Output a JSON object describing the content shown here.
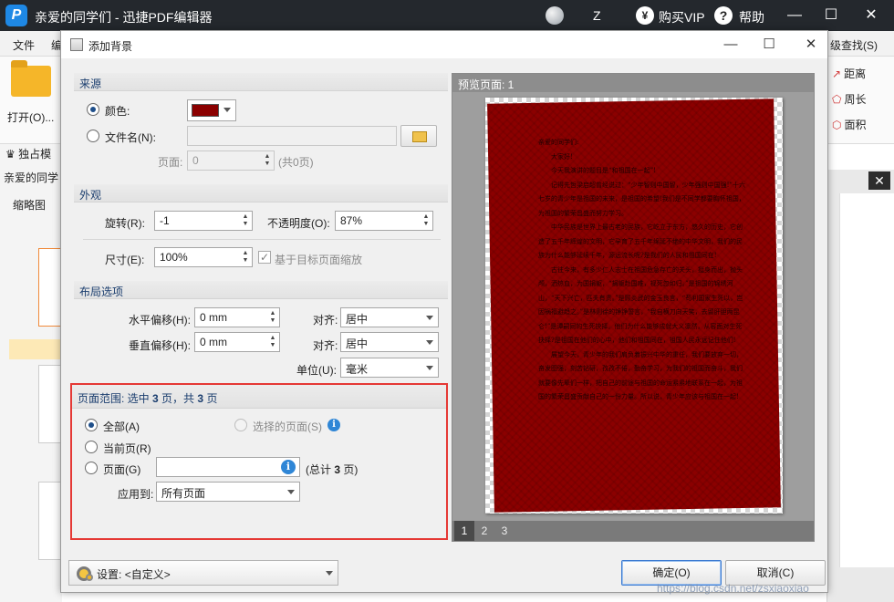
{
  "app": {
    "title": "亲爱的同学们 - 迅捷PDF编辑器",
    "logo": "P",
    "user": "Z",
    "vip_icon": "¥",
    "buy_vip": "购买VIP",
    "help_icon": "?",
    "help": "帮助",
    "minimize": "—",
    "maximize": "☐",
    "close": "✕"
  },
  "backdrop": {
    "menu": [
      "文件",
      "编"
    ],
    "menu_right": "级查找(S)",
    "open_label": "打开(O)...",
    "exclusive": "独占模",
    "doc_tab": "亲爱的同学",
    "thumbs_title": "缩略图",
    "right_tools": [
      "距离",
      "周长",
      "面积"
    ],
    "panel_close": "✕"
  },
  "dialog": {
    "title": "添加背景",
    "minimize": "—",
    "maximize": "☐",
    "close": "✕",
    "source": {
      "header": "来源",
      "color_label": "颜色:",
      "color_value": "#8b0000",
      "file_label": "文件名(N):",
      "file_value": "",
      "page_label": "页面:",
      "page_value": "0",
      "page_total": "(共0页)"
    },
    "appearance": {
      "header": "外观",
      "rotate_label": "旋转(R):",
      "rotate_value": "-1",
      "opacity_label": "不透明度(O):",
      "opacity_value": "87%",
      "size_label": "尺寸(E):",
      "size_value": "100%",
      "scale_label": "基于目标页面缩放",
      "scale_checked": true
    },
    "layout": {
      "header": "布局选项",
      "h_offset_label": "水平偏移(H):",
      "h_offset_value": "0 mm",
      "h_align_label": "对齐:",
      "h_align_value": "居中",
      "v_offset_label": "垂直偏移(H):",
      "v_offset_value": "0 mm",
      "v_align_label": "对齐:",
      "v_align_value": "居中",
      "unit_label": "单位(U):",
      "unit_value": "毫米"
    },
    "range": {
      "header_prefix": "页面范围: 选中",
      "selected": "3",
      "header_mid": "页，共",
      "total": "3",
      "header_suffix": "页",
      "all_label": "全部(A)",
      "selected_pages_label": "选择的页面(S)",
      "current_label": "当前页(R)",
      "pages_label": "页面(G)",
      "pages_value": "",
      "pages_total_prefix": "(总计",
      "pages_total": "3",
      "pages_total_suffix": "页)",
      "apply_label": "应用到:",
      "apply_value": "所有页面"
    },
    "preview": {
      "header": "预览页面: 1",
      "pages": [
        "1",
        "2",
        "3"
      ],
      "text": {
        "greeting": "亲爱的同学们:",
        "hello": "大家好!",
        "p1": "今天我演讲的题目是“和祖国在一起”!",
        "p2": "记得先哲梁启超曾经说过：“少年智则中国智，少年强则中国强!”十六七岁的青少年是祖国的未来，是祖国的希望!我们是不同学都要胸怀祖国，为祖国的繁荣昌盛而努力学习。",
        "p3": "中华民族是世界上最古老的民族，它屹立于东方，悠久的历史，它创造了五千年辉煌的文明，它孕育了五千年绵延不绝的中华文明，我们的民族为什么能够延续千年，源远流长呢?是我们的人民和祖国同在!",
        "p4": "古往今来，有多少仁人志士在祖国危急存亡的关头，挺身而出，抛头颅，洒热血，为国捐躯，“捐躯赴国难，视死忽如归。”是祖国的锦绣河山，“天下兴亡，匹夫有责。”是顾炎武的金玉良言，“苟利国家生死以，岂因祸福避趋之。”是林则徐的铮铮誓言，“我自横刀向天笑，去留肝胆两昆仑!”是谭嗣同的生死抉择。他们为什么能够成就大义凛然，从容面对生死抉择?是祖国在他们的心中，他们和祖国同在，祖国人民永远记住他们!",
        "p5": "展望今天，青少年的我们肩负着振兴中华的重任，我们要放弃一切，奋发图强，刻苦钻研，孜孜不倦，勤奋学习，为我们的祖国而奋斗，我们就要像先辈们一样，把自己的前途与祖国的命运紧紧地联系在一起，为祖国的繁荣昌盛贡献自己的一份力量。所以说，青少年应该与祖国在一起!"
      }
    },
    "footer": {
      "settings_label": "设置:",
      "settings_value": "<自定义>",
      "ok": "确定(O)",
      "cancel": "取消(C)"
    }
  },
  "watermark": "https://blog.csdn.net/zsxiaoxiao",
  "colors": {
    "highlight": "#e53935",
    "background_fill": "#8b0000",
    "accent": "#1f4f8a"
  },
  "icons": {
    "folder": "folder-icon",
    "gear": "gear-icon",
    "info": "info-icon",
    "browse": "folder-browse-icon"
  }
}
